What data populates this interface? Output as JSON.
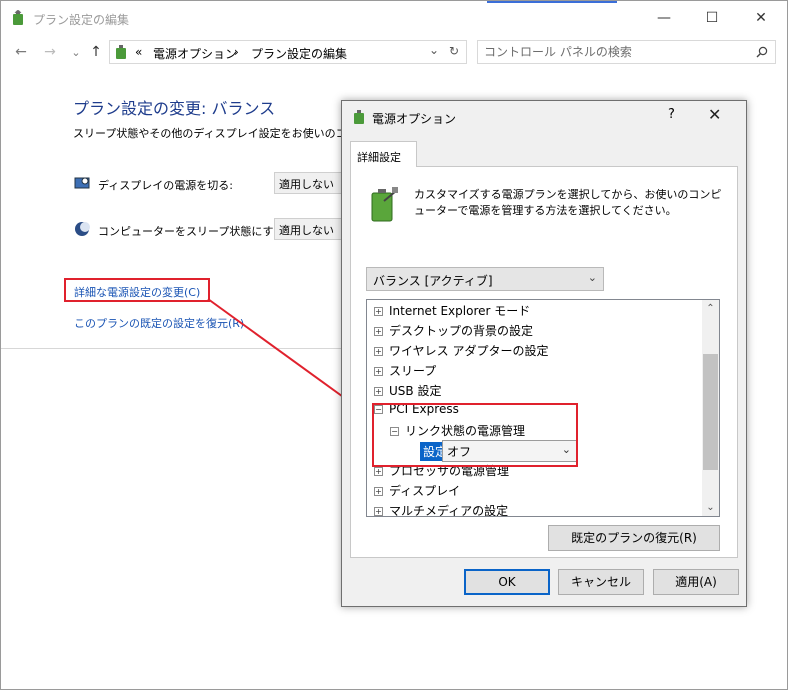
{
  "window": {
    "title": "プラン設定の編集",
    "minimize_glyph": "—",
    "maximize_glyph": "☐",
    "close_glyph": "✕"
  },
  "nav": {
    "back_glyph": "←",
    "forward_glyph": "→",
    "recent_glyph": "⌄",
    "up_glyph": "↑",
    "breadcrumb_prefix": "«",
    "breadcrumb": [
      "電源オプション",
      "プラン設定の編集"
    ],
    "breadcrumb_sep": "›",
    "dropdown_glyph": "⌄",
    "refresh_glyph": "↻",
    "search_placeholder": "コントロール パネルの検索"
  },
  "content": {
    "title": "プラン設定の変更: バランス",
    "description": "スリープ状態やその他のディスプレイ設定をお使いのコンピ",
    "display_off_label": "ディスプレイの電源を切る:",
    "display_off_value": "適用しない",
    "sleep_label": "コンピューターをスリープ状態にする:",
    "sleep_value": "適用しない",
    "advanced_link": "詳細な電源設定の変更(C)",
    "restore_link": "このプランの既定の設定を復元(R)"
  },
  "dialog": {
    "title": "電源オプション",
    "help_glyph": "?",
    "close_glyph": "✕",
    "tab": "詳細設定",
    "intro": "カスタマイズする電源プランを選択してから、お使いのコンピューターで電源を管理する方法を選択してください。",
    "plan_select": "バランス [アクティブ]",
    "tree": [
      {
        "label": "Internet Explorer モード",
        "level": 0,
        "expander": "+"
      },
      {
        "label": "デスクトップの背景の設定",
        "level": 0,
        "expander": "+"
      },
      {
        "label": "ワイヤレス アダプターの設定",
        "level": 0,
        "expander": "+"
      },
      {
        "label": "スリープ",
        "level": 0,
        "expander": "+"
      },
      {
        "label": "USB 設定",
        "level": 0,
        "expander": "+"
      },
      {
        "label": "PCI Express",
        "level": 0,
        "expander": "−"
      },
      {
        "label": "リンク状態の電源管理",
        "level": 1,
        "expander": "−"
      },
      {
        "label": "",
        "level": 2,
        "expander": ""
      },
      {
        "label": "プロセッサの電源管理",
        "level": 0,
        "expander": "+"
      },
      {
        "label": "ディスプレイ",
        "level": 0,
        "expander": "+"
      },
      {
        "label": "マルチメディアの設定",
        "level": 0,
        "expander": "+"
      }
    ],
    "setting_label": "設定:",
    "setting_value": "オフ",
    "restore_button": "既定のプランの復元(R)",
    "ok_button": "OK",
    "cancel_button": "キャンセル",
    "apply_button": "適用(A)"
  },
  "colors": {
    "accent": "#0a64c8",
    "highlight_box": "#e0212d",
    "link": "#1a54b4",
    "title_blue": "#1e3c8c"
  }
}
